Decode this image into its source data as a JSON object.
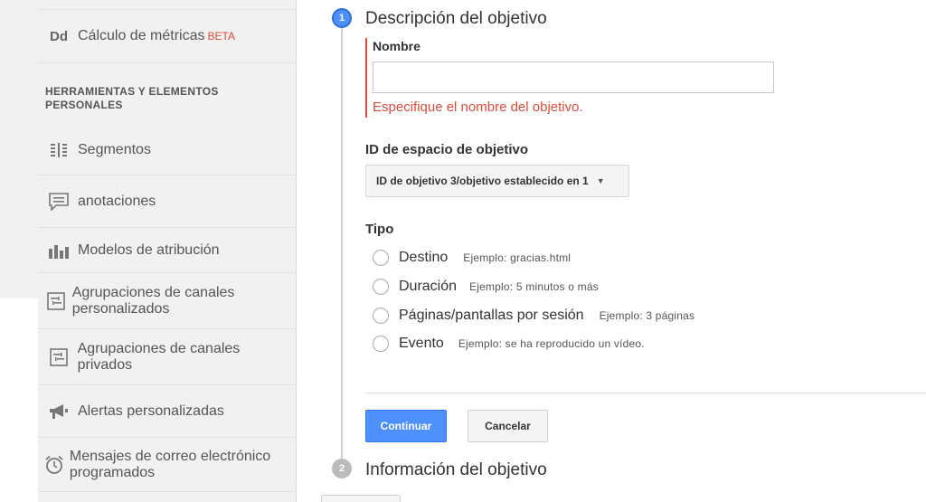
{
  "sidebar": {
    "metrics_item": {
      "icon_text": "Dd",
      "label": "Cálculo de métricas",
      "badge": "BETA"
    },
    "section_title": "HERRAMIENTAS Y ELEMENTOS PERSONALES",
    "items": [
      {
        "label": "Segmentos",
        "icon": "segments-icon"
      },
      {
        "label": "anotaciones",
        "icon": "annotations-icon"
      },
      {
        "label": "Modelos de atribución",
        "icon": "bar-chart-icon"
      },
      {
        "label": "Agrupaciones de canales personalizados",
        "icon": "channel-groupings-icon"
      },
      {
        "label": "Agrupaciones de canales privados",
        "icon": "channel-groupings-icon"
      },
      {
        "label": "Alertas personalizadas",
        "icon": "megaphone-icon"
      },
      {
        "label": "Mensajes de correo electrónico programados",
        "icon": "alarm-clock-icon"
      }
    ]
  },
  "steps": {
    "step1": {
      "number": "1",
      "title": "Descripción del objetivo"
    },
    "step2": {
      "number": "2",
      "title": "Información del objetivo"
    }
  },
  "form": {
    "name_label": "Nombre",
    "name_value": "",
    "name_error": "Especifique el nombre del objetivo.",
    "slot_label": "ID de espacio de objetivo",
    "slot_value": "ID de objetivo 3/objetivo establecido en 1",
    "type_label": "Tipo",
    "types": [
      {
        "label": "Destino",
        "example": "Ejemplo: gracias.html"
      },
      {
        "label": "Duración",
        "example": "Ejemplo: 5 minutos o más"
      },
      {
        "label": "Páginas/pantallas por sesión",
        "example": "Ejemplo: 3 páginas"
      },
      {
        "label": "Evento",
        "example": "Ejemplo: se ha reproducido un vídeo."
      }
    ],
    "continue_label": "Continuar",
    "cancel_label": "Cancelar"
  },
  "colors": {
    "accent": "#4d90fe",
    "error": "#dd4b39",
    "sidebar_bg": "#f1f1f1"
  }
}
